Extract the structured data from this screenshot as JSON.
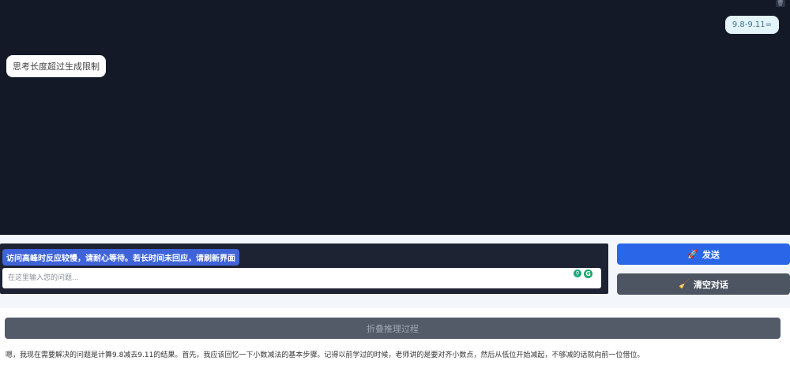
{
  "chat": {
    "user_message": "9.8-9.11=",
    "bot_message": "思考长度超过生成限制",
    "trash_icon": "trash-icon"
  },
  "input": {
    "notice": "访问高峰时反应较慢，请耐心等待。若长时间未回应，请刷新界面",
    "placeholder": "在这里输入您的问题...",
    "value": ""
  },
  "buttons": {
    "send_icon": "🚀",
    "send_label": "发送",
    "clear_icon": "🧹",
    "clear_label": "清空对话"
  },
  "reasoning": {
    "toggle_label": "折叠推理过程",
    "text": "嗯，我现在需要解决的问题是计算9.8减去9.11的结果。首先，我应该回忆一下小数减法的基本步骤。记得以前学过的时候，老师讲的是要对齐小数点，然后从低位开始减起，不够减的话就向前一位借位。"
  },
  "colors": {
    "chat_bg": "#141927",
    "send_button": "#2a67e8",
    "clear_button": "#4d5563",
    "notice_bg": "#3f63d8"
  }
}
